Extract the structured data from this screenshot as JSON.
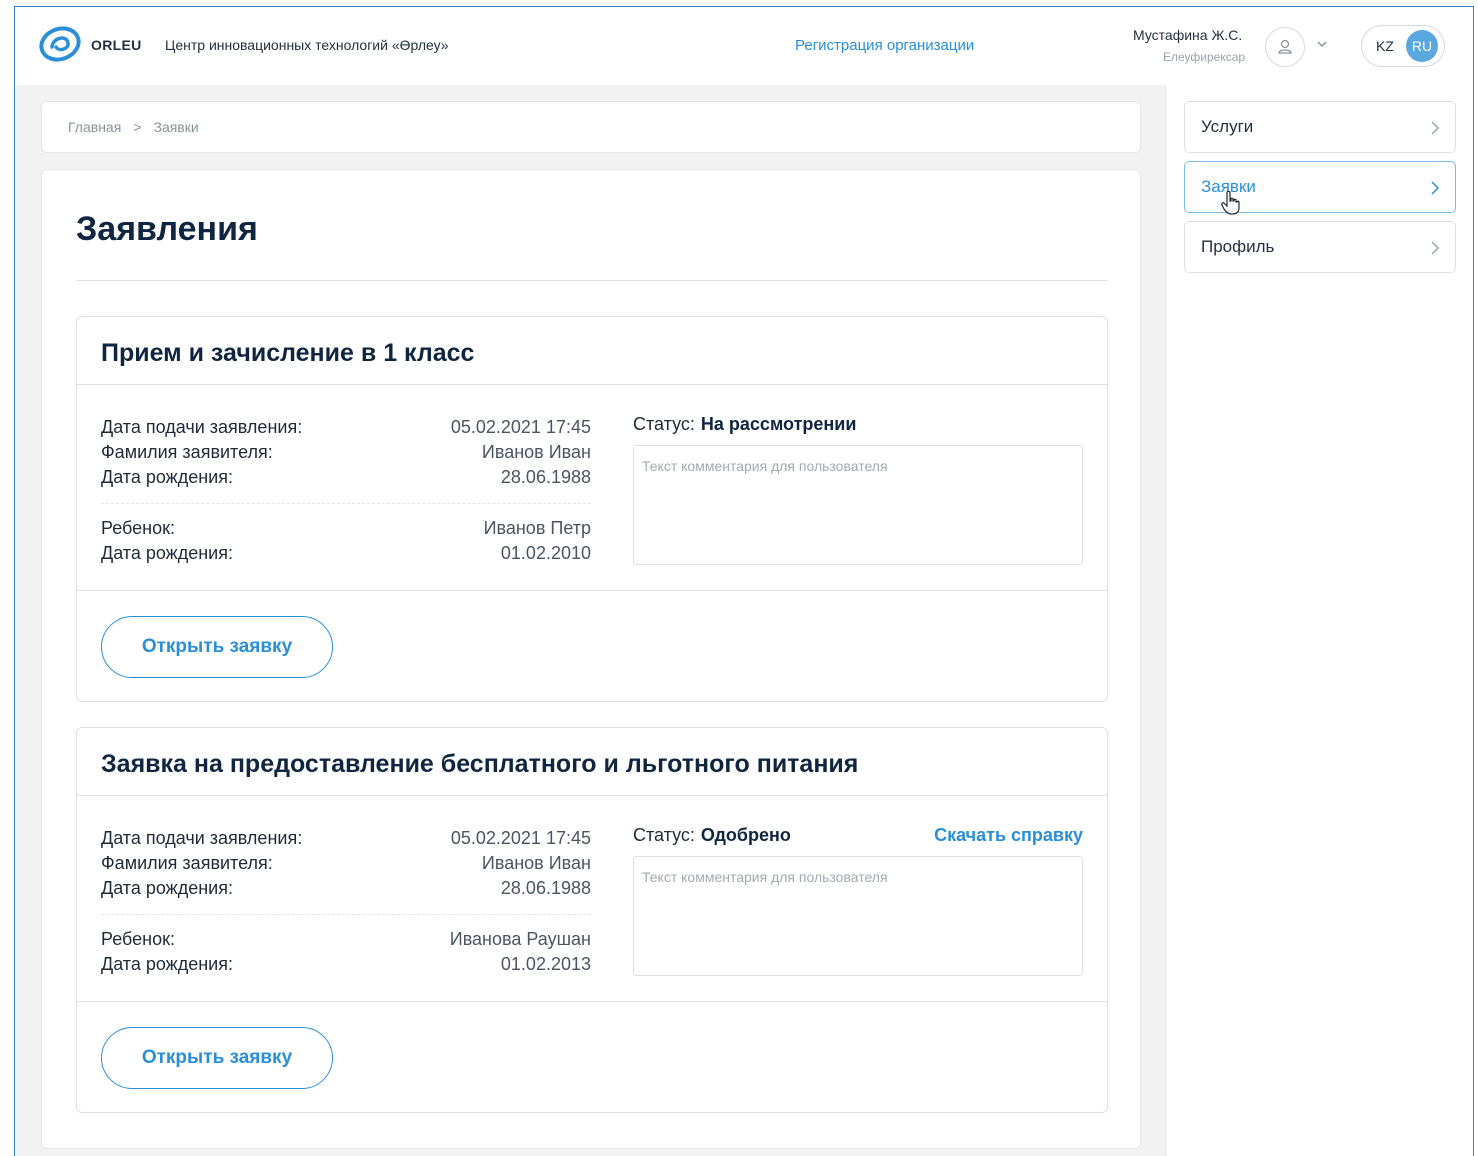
{
  "header": {
    "brand": "ORLEU",
    "org_name": "Центр инновационных технологий «Өрлеу»",
    "register_link": "Регистрация организации",
    "user_name": "Мустафина Ж.С.",
    "user_role": "Елеуфирексар",
    "lang_kz": "KZ",
    "lang_ru": "RU",
    "icons": [
      "orleu-logo",
      "user-icon",
      "chevron-down-icon"
    ]
  },
  "breadcrumb": {
    "home": "Главная",
    "separator": ">",
    "current": "Заявки"
  },
  "page": {
    "title": "Заявления"
  },
  "applications": [
    {
      "title": "Прием и зачисление в 1 класс",
      "fields": [
        {
          "label": "Дата подачи заявления:",
          "value": "05.02.2021 17:45"
        },
        {
          "label": "Фамилия заявителя:",
          "value": "Иванов Иван"
        },
        {
          "label": "Дата рождения:",
          "value": "28.06.1988"
        }
      ],
      "child_fields": [
        {
          "label": "Ребенок:",
          "value": "Иванов Петр"
        },
        {
          "label": "Дата рождения:",
          "value": "01.02.2010"
        }
      ],
      "status_label": "Статус:",
      "status_value": "На рассмотрении",
      "download_link": "",
      "comment_placeholder": "Текст комментария для пользователя",
      "open_button": "Открыть заявку"
    },
    {
      "title": "Заявка на предоставление бесплатного и льготного питания",
      "fields": [
        {
          "label": "Дата подачи заявления:",
          "value": "05.02.2021 17:45"
        },
        {
          "label": "Фамилия заявителя:",
          "value": "Иванов Иван"
        },
        {
          "label": "Дата рождения:",
          "value": "28.06.1988"
        }
      ],
      "child_fields": [
        {
          "label": "Ребенок:",
          "value": "Иванова Раушан"
        },
        {
          "label": "Дата рождения:",
          "value": "01.02.2013"
        }
      ],
      "status_label": "Статус:",
      "status_value": "Одобрено",
      "download_link": "Скачать справку",
      "comment_placeholder": "Текст комментария для пользователя",
      "open_button": "Открыть заявку"
    }
  ],
  "sidebar": {
    "items": [
      {
        "label": "Услуги",
        "active": false
      },
      {
        "label": "Заявки",
        "active": true
      },
      {
        "label": "Профиль",
        "active": false
      }
    ]
  },
  "colors": {
    "accent": "#2a8fd6",
    "title": "#10253f",
    "lang_active": "#5aa7e0",
    "frame_border": "#3b82c4"
  }
}
